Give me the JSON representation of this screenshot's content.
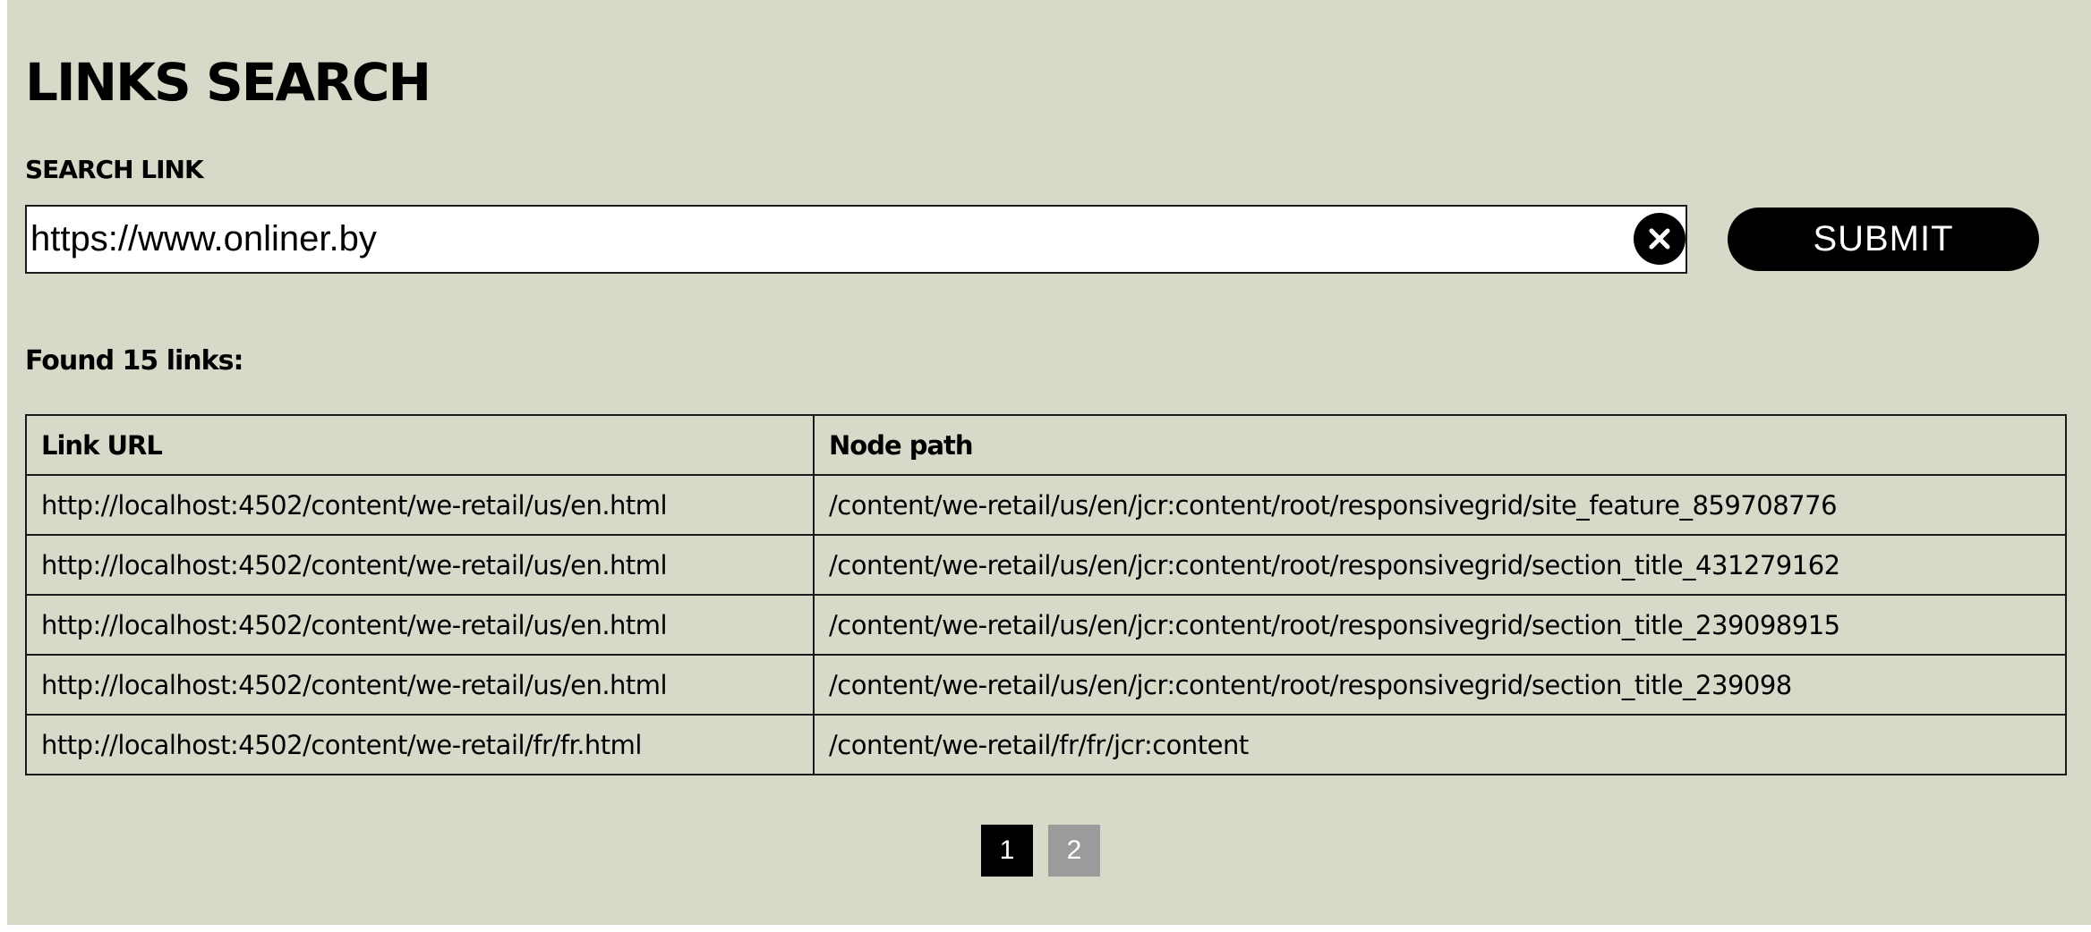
{
  "header": {
    "title": "LINKS SEARCH"
  },
  "search": {
    "label": "SEARCH LINK",
    "value": "https://www.onliner.by",
    "clear_icon": "close-circle-icon",
    "submit_label": "SUBMIT"
  },
  "results": {
    "summary": "Found 15 links:",
    "columns": [
      "Link URL",
      "Node path"
    ],
    "rows": [
      {
        "url": "http://localhost:4502/content/we-retail/us/en.html",
        "path": "/content/we-retail/us/en/jcr:content/root/responsivegrid/site_feature_859708776"
      },
      {
        "url": "http://localhost:4502/content/we-retail/us/en.html",
        "path": "/content/we-retail/us/en/jcr:content/root/responsivegrid/section_title_431279162"
      },
      {
        "url": "http://localhost:4502/content/we-retail/us/en.html",
        "path": "/content/we-retail/us/en/jcr:content/root/responsivegrid/section_title_239098915"
      },
      {
        "url": "http://localhost:4502/content/we-retail/us/en.html",
        "path": "/content/we-retail/us/en/jcr:content/root/responsivegrid/section_title_239098"
      },
      {
        "url": "http://localhost:4502/content/we-retail/fr/fr.html",
        "path": "/content/we-retail/fr/fr/jcr:content"
      }
    ]
  },
  "pagination": {
    "pages": [
      "1",
      "2"
    ],
    "current": "1"
  },
  "colors": {
    "background": "#d7dac9",
    "accent": "#000000",
    "inactive_page": "#9b9b9b"
  }
}
